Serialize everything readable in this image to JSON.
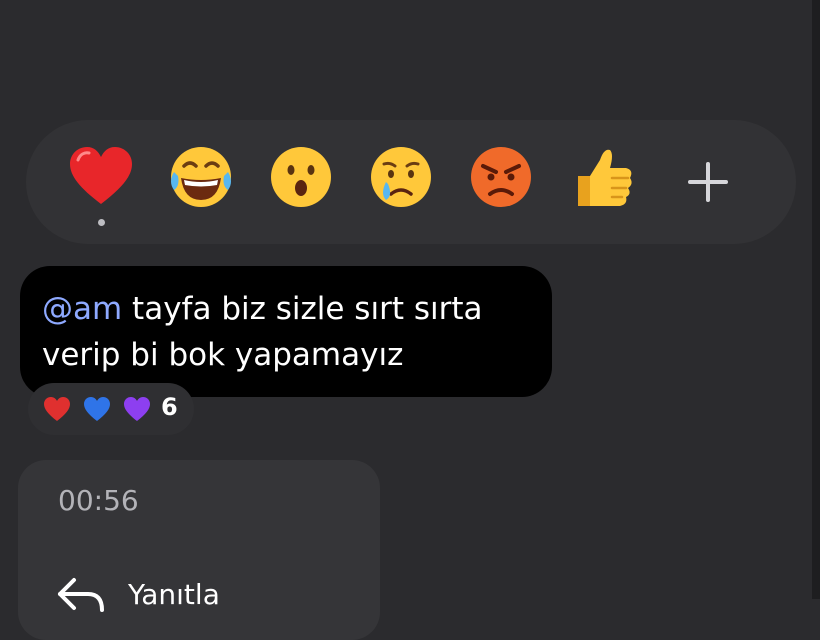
{
  "reaction_picker": {
    "emojis": [
      "heart",
      "face-with-tears-of-joy",
      "surprised-face",
      "crying-face",
      "angry-face",
      "thumbs-up"
    ],
    "selected": "heart",
    "more_label": "+"
  },
  "message": {
    "mention": "@am",
    "text": " tayfa biz sizle sırt sırta verip bi bok yapamayız"
  },
  "reactions": {
    "hearts": [
      "red-heart",
      "blue-heart",
      "purple-heart"
    ],
    "count": "6",
    "colors": {
      "red": "#e0302f",
      "blue": "#2f74e8",
      "purple": "#8d3ff0"
    }
  },
  "context_menu": {
    "time": "00:56",
    "items": [
      {
        "label": "Yanıtla",
        "icon": "reply-arrow-icon"
      }
    ]
  },
  "colors": {
    "background": "#2b2b2e",
    "bubble": "#000000",
    "mention": "#8ea9ff",
    "menu": "#353538"
  }
}
